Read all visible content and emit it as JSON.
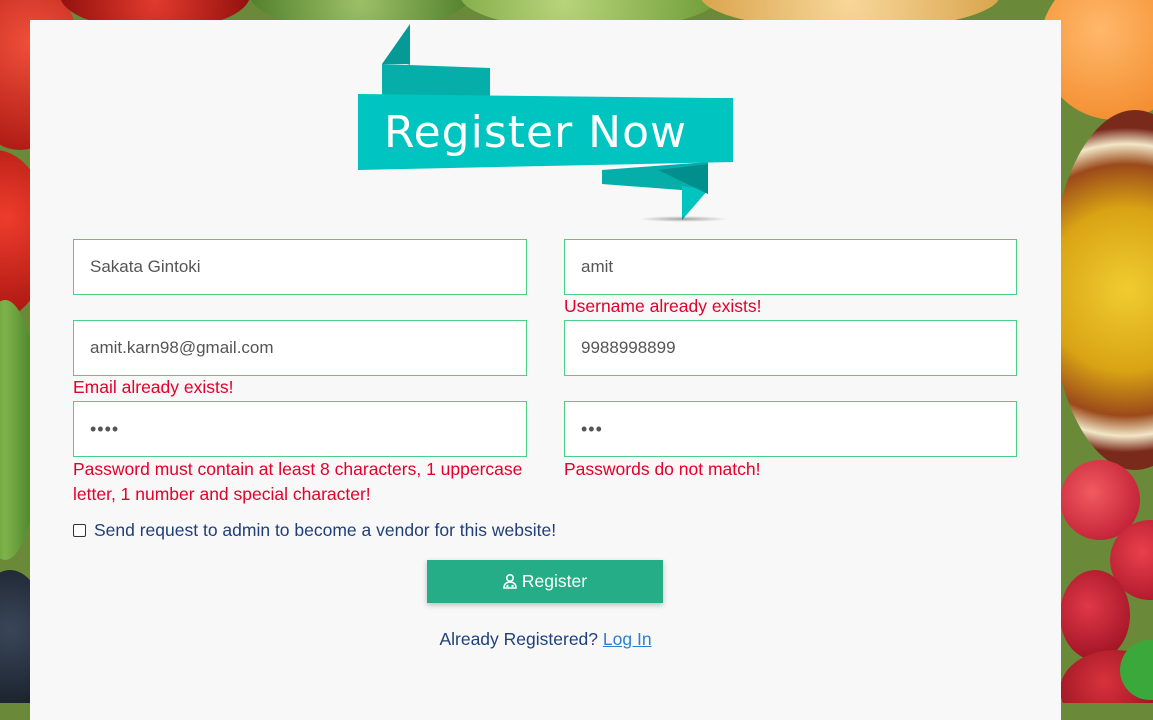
{
  "banner": {
    "text": "Register Now"
  },
  "form": {
    "full_name": {
      "value": "Sakata Gintoki"
    },
    "username": {
      "value": "amit",
      "error": "Username already exists!"
    },
    "email": {
      "value": "amit.karn98@gmail.com",
      "error": "Email already exists!"
    },
    "phone": {
      "value": "9988998899"
    },
    "password": {
      "masked": "••••",
      "error": "Password must contain at least 8 characters, 1 uppercase letter, 1 number and special character!"
    },
    "confirm_password": {
      "masked": "•••",
      "error": "Passwords do not match!"
    },
    "vendor_checkbox": {
      "label": "Send request to admin to become a vendor for this website!",
      "checked": false
    },
    "register_button": {
      "label": "Register",
      "icon": "user-icon"
    }
  },
  "footer": {
    "prompt": "Already Registered?",
    "login_link": "Log In"
  },
  "colors": {
    "accent": "#24ad86",
    "banner": "#00c4c0",
    "error": "#e4002b",
    "text_blue": "#1f3f7a",
    "link": "#2f7fd0",
    "field_border": "#4ecf86"
  }
}
